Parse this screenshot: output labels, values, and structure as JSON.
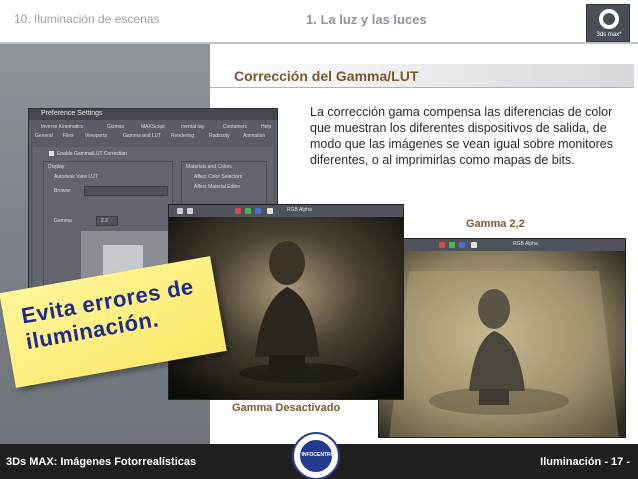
{
  "header": {
    "section_title": "10. Iluminación de escenas",
    "chapter_title": "1. La luz y las luces",
    "logo_text": "3ds max*"
  },
  "heading": "Corrección del Gamma/LUT",
  "body_text": "La corrección gama compensa las diferencias de color que muestran los diferentes  dispositivos de salida, de modo que las imágenes se vean igual sobre monitores diferentes, o al imprimirlas como mapas de bits.",
  "preference_dialog": {
    "title": "Preference Settings",
    "tabs_row1": [
      "Inverse Kinematics",
      "Gizmos",
      "MAXScript",
      "mental ray",
      "Containers",
      "Help"
    ],
    "tabs_row2": [
      "General",
      "Files",
      "Viewports",
      "Gamma and LUT",
      "Rendering",
      "Radiosity",
      "Animation"
    ],
    "enable_label": "Enable Gamma/LUT Correction",
    "display_label": "Display",
    "autodesk_lut": "Autodesk View LUT",
    "browse_label": "Browse",
    "gamma_label": "Gamma",
    "gamma_value": "2.2",
    "materials_label": "Materials and Colors",
    "affect_color_selectors": "Affect Color Selectors",
    "affect_material_editor": "Affect Material Editor"
  },
  "render_toolbar": {
    "channel_label": "RGB Alpha"
  },
  "sticky_note": {
    "line1": "Evita errores de",
    "line2": "iluminación."
  },
  "captions": {
    "right": "Gamma 2,2",
    "bottom": "Gamma Desactivado"
  },
  "footer": {
    "left": "3Ds MAX: Imágenes Fotorrealísticas",
    "right": "Iluminación  - 17 -",
    "badge_text": "INFOCENTRO"
  }
}
